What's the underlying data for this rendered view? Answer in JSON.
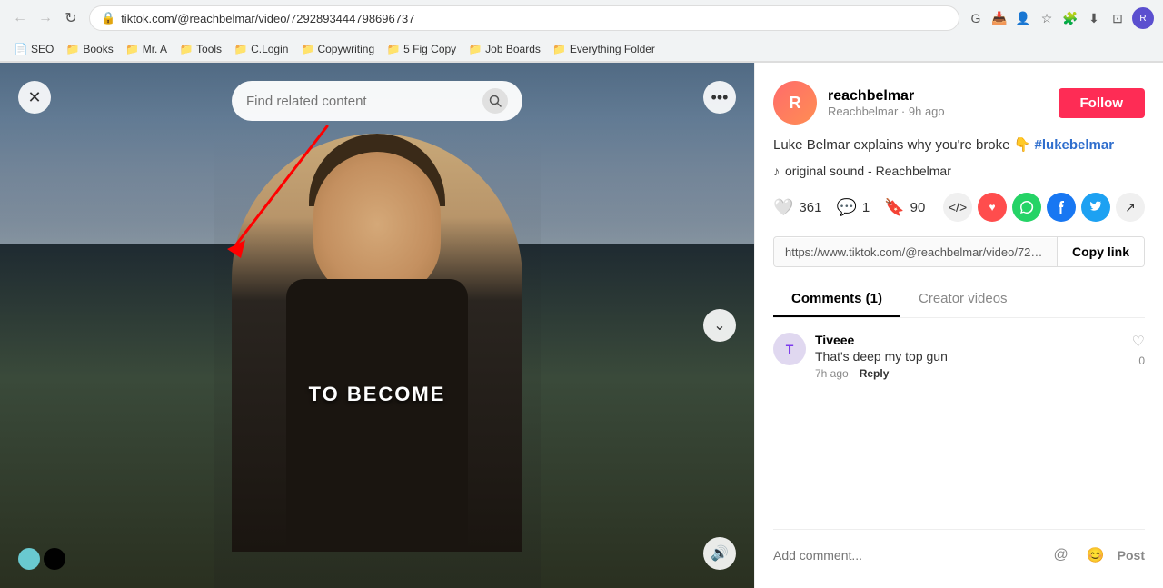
{
  "browser": {
    "url": "tiktok.com/@reachbelmar/video/7292893444798696737",
    "back_disabled": false,
    "forward_disabled": false
  },
  "bookmarks": [
    {
      "label": "SEO",
      "type": "link"
    },
    {
      "label": "Books",
      "type": "folder"
    },
    {
      "label": "Mr. A",
      "type": "folder"
    },
    {
      "label": "Tools",
      "type": "folder"
    },
    {
      "label": "C.Login",
      "type": "folder"
    },
    {
      "label": "Copywriting",
      "type": "folder"
    },
    {
      "label": "5 Fig Copy",
      "type": "folder"
    },
    {
      "label": "Job Boards",
      "type": "folder"
    },
    {
      "label": "Everything Folder",
      "type": "folder-green"
    }
  ],
  "search_bar": {
    "placeholder": "Find related content"
  },
  "video": {
    "overlay_text": "TO BECOME"
  },
  "creator": {
    "name": "reachbelmar",
    "handle": "Reachbelmar · 9h ago",
    "avatar_initial": "R",
    "follow_label": "Follow"
  },
  "description": {
    "text": "Luke Belmar explains why you're broke 👇",
    "hashtag": "#lukebelmar"
  },
  "sound": {
    "text": "original sound - Reachbelmar"
  },
  "stats": {
    "likes": "361",
    "comments": "1",
    "bookmarks": "90"
  },
  "url_bar": {
    "url": "https://www.tiktok.com/@reachbelmar/video/7292893...",
    "copy_label": "Copy link"
  },
  "tabs": [
    {
      "label": "Comments (1)",
      "active": true
    },
    {
      "label": "Creator videos",
      "active": false
    }
  ],
  "comments": [
    {
      "username": "Tiveee",
      "text": "That's deep my top gun",
      "time": "7h ago",
      "reply_label": "Reply",
      "likes": "0"
    }
  ],
  "add_comment": {
    "placeholder": "Add comment...",
    "post_label": "Post"
  }
}
